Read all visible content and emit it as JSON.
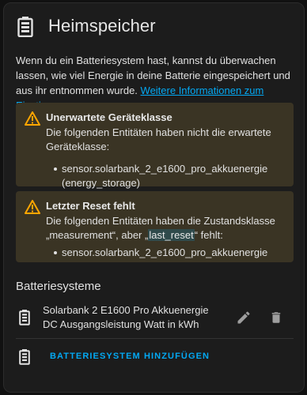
{
  "header": {
    "icon": "battery-icon",
    "title": "Heimspeicher"
  },
  "intro": {
    "text": "Wenn du ein Batteriesystem hast, kannst du überwachen lassen, wie viel Energie in deine Batterie eingespeichert und aus ihr entnommen wurde. ",
    "link": "Weitere Informationen zum Einstieg."
  },
  "alerts": [
    {
      "icon": "warning-icon",
      "title": "Unerwartete Geräteklasse",
      "body": "Die folgenden Entitäten haben nicht die erwartete Geräteklasse:",
      "items": [
        "sensor.solarbank_2_e1600_pro_akkuenergie (energy_storage)"
      ]
    },
    {
      "icon": "warning-icon",
      "title": "Letzter Reset fehlt",
      "body_before": "Die folgenden Entitäten haben die Zustandsklasse „measurement“, aber „",
      "body_highlight": "last_reset",
      "body_after": "“ fehlt:",
      "items": [
        "sensor.solarbank_2_e1600_pro_akkuenergie"
      ]
    }
  ],
  "section": {
    "title": "Batteriesysteme",
    "rows": [
      {
        "icon": "battery-icon",
        "line1": "Solarbank 2 E1600 Pro Akkuenergie",
        "line2": "DC Ausgangsleistung Watt in kWh",
        "edit_icon": "pencil-icon",
        "delete_icon": "trash-icon"
      }
    ],
    "add_label": "BATTERIESYSTEM HINZUFÜGEN"
  },
  "colors": {
    "accent": "#03a9f4",
    "warning": "#ffa600",
    "alert_bg": "#3a3424",
    "card_bg": "#1c1c1c"
  }
}
